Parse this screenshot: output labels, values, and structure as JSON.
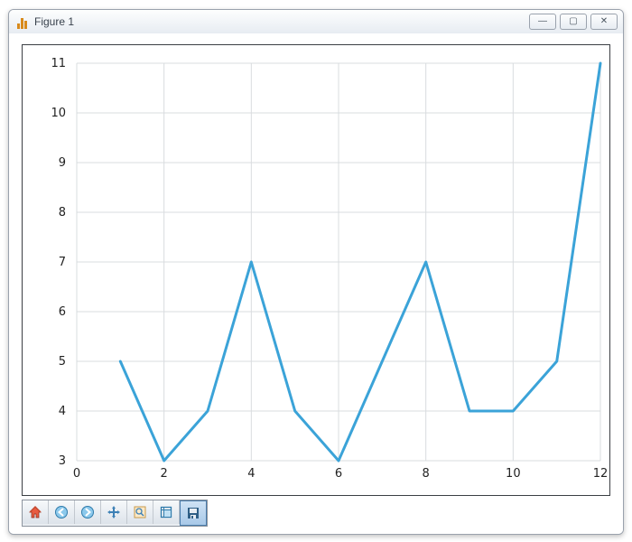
{
  "window": {
    "title": "Figure 1",
    "buttons": {
      "minimize_glyph": "—",
      "maximize_glyph": "▢",
      "close_glyph": "✕"
    }
  },
  "toolbar": {
    "items": [
      {
        "name": "home-icon"
      },
      {
        "name": "back-icon"
      },
      {
        "name": "forward-icon"
      },
      {
        "name": "pan-icon"
      },
      {
        "name": "zoom-icon"
      },
      {
        "name": "configure-icon"
      },
      {
        "name": "save-icon"
      }
    ]
  },
  "chart_data": {
    "type": "line",
    "x": [
      1,
      2,
      3,
      4,
      5,
      6,
      7,
      8,
      9,
      10,
      11,
      12
    ],
    "y": [
      5,
      3,
      4,
      7,
      4,
      3,
      5,
      7,
      4,
      4,
      5,
      11
    ],
    "x_ticks": [
      0,
      2,
      4,
      6,
      8,
      10,
      12
    ],
    "y_ticks": [
      3,
      4,
      5,
      6,
      7,
      8,
      9,
      10,
      11
    ],
    "xlim": [
      0,
      12
    ],
    "ylim": [
      3,
      11
    ],
    "grid": true,
    "title": "",
    "xlabel": "",
    "ylabel": ""
  }
}
